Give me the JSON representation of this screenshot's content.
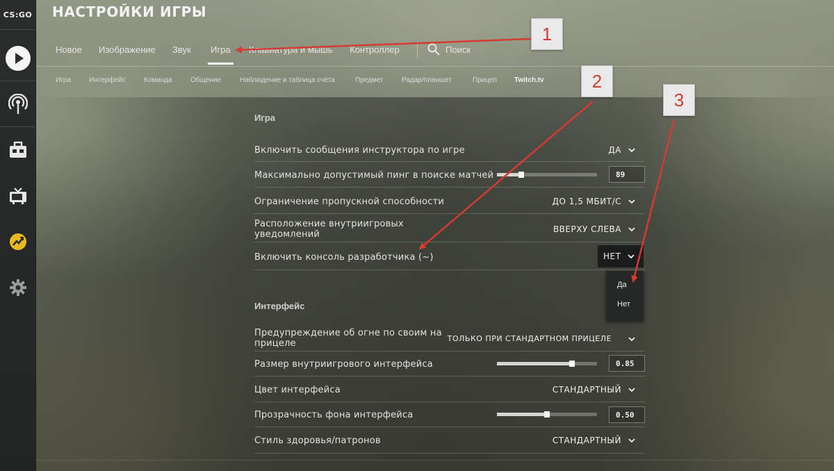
{
  "sidebar": {
    "logo": "CS:GO",
    "icons": [
      "play-icon",
      "broadcast-icon",
      "inventory-icon",
      "tv-icon",
      "stats-icon",
      "settings-gear-icon"
    ]
  },
  "header": {
    "title": "НАСТРОЙКИ ИГРЫ",
    "tabs": [
      "Новое",
      "Изображение",
      "Звук",
      "Игра",
      "Клавиатура и мышь",
      "Контроллер"
    ],
    "active_tab": "Игра",
    "search_label": "Поиск"
  },
  "subtabs": [
    "Игра",
    "Интерфейс",
    "Команда",
    "Общение",
    "Наблюдение и таблица счёта",
    "Предмет",
    "Радар/планшет",
    "Прицел",
    "Twitch.tv"
  ],
  "sections": {
    "game": {
      "title": "Игра",
      "rows": [
        {
          "label": "Включить сообщения инструктора по игре",
          "value": "ДА"
        },
        {
          "label": "Максимально допустимый пинг в поиске матчей",
          "value": "89",
          "level": 0.24
        },
        {
          "label": "Ограничение пропускной способности",
          "value": "ДО 1,5 МБИТ/С"
        },
        {
          "label": "Расположение внутриигровых уведомлений",
          "value": "ВВЕРХУ СЛЕВА"
        },
        {
          "label": "Включить консоль разработчика (~)",
          "value": "НЕТ"
        }
      ]
    },
    "interface": {
      "title": "Интерфейс",
      "rows": [
        {
          "label": "Предупреждение об огне по своим на прицеле",
          "value": "ТОЛЬКО ПРИ СТАНДАРТНОМ ПРИЦЕЛЕ"
        },
        {
          "label": "Размер внутриигрового интерфейса",
          "value": "0.85",
          "level": 0.75
        },
        {
          "label": "Цвет интерфейса",
          "value": "СТАНДАРТНЫЙ"
        },
        {
          "label": "Прозрачность фона интерфейса",
          "value": "0.50",
          "level": 0.5
        },
        {
          "label": "Стиль здоровья/патронов",
          "value": "СТАНДАРТНЫЙ"
        }
      ]
    }
  },
  "dropdown": {
    "current": "НЕТ",
    "options": [
      "Да",
      "Нет"
    ]
  },
  "annotations": {
    "badges": [
      "1",
      "2",
      "3"
    ],
    "color": "#d43b32"
  }
}
